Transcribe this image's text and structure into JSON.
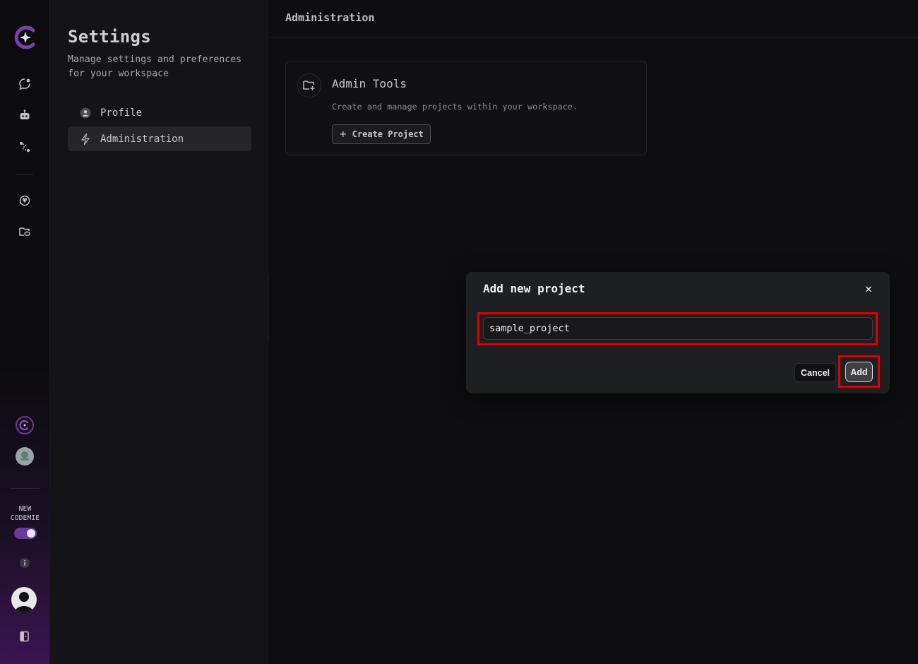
{
  "rail": {
    "logo_icon": "codemie-logo-icon",
    "top_icons": [
      "chat-icon",
      "robot-icon",
      "workflow-icon"
    ],
    "mid_icons": [
      "brain-icon",
      "folder-link-icon"
    ],
    "bottom_icons": [
      "codemie-circle-icon",
      "org-badge-icon"
    ],
    "new_codemie_label_1": "NEW",
    "new_codemie_label_2": "CODEMIE",
    "toggle_on": true,
    "info_icon": "info-icon",
    "exit_icon": "logout-icon"
  },
  "settings_panel": {
    "title": "Settings",
    "subtitle": "Manage settings and preferences for your workspace",
    "items": [
      {
        "label": "Profile",
        "icon": "user-icon",
        "active": false
      },
      {
        "label": "Administration",
        "icon": "lightning-icon",
        "active": true
      }
    ]
  },
  "main": {
    "header_title": "Administration",
    "card": {
      "title": "Admin Tools",
      "description": "Create and manage projects within your workspace.",
      "button_label": "Create Project"
    }
  },
  "modal": {
    "title": "Add new project",
    "input_value": "sample_project",
    "cancel_label": "Cancel",
    "add_label": "Add",
    "close_symbol": "✕"
  },
  "colors": {
    "highlight": "#e00000",
    "accent": "#6a3a9a"
  }
}
